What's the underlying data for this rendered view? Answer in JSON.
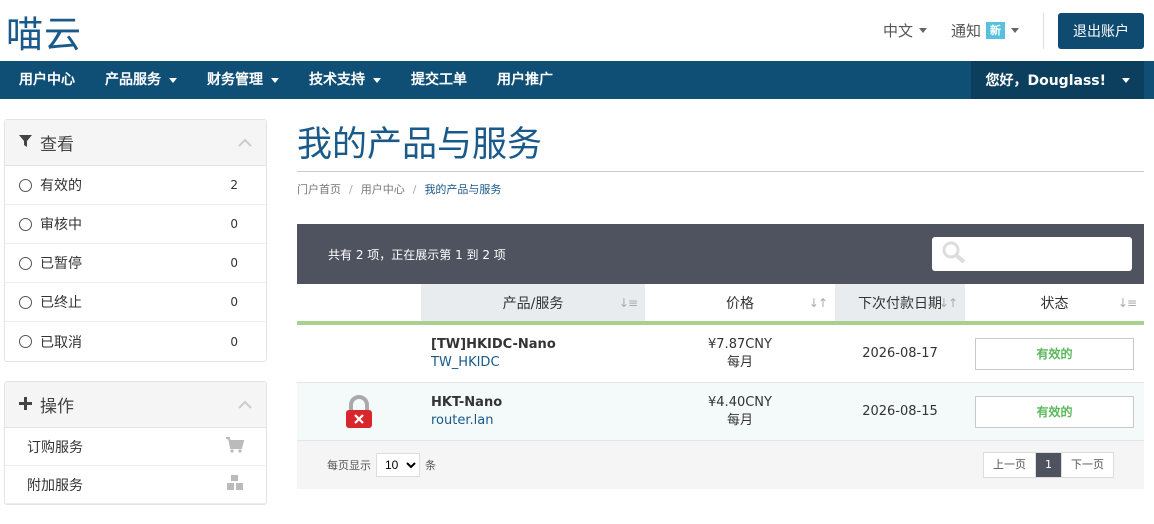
{
  "header": {
    "logo": "喵云",
    "lang_label": "中文",
    "notify_label": "通知",
    "notify_badge": "新",
    "logout_label": "退出账户"
  },
  "nav": {
    "items": [
      {
        "label": "用户中心",
        "dropdown": false
      },
      {
        "label": "产品服务",
        "dropdown": true
      },
      {
        "label": "财务管理",
        "dropdown": true
      },
      {
        "label": "技术支持",
        "dropdown": true
      },
      {
        "label": "提交工单",
        "dropdown": false
      },
      {
        "label": "用户推广",
        "dropdown": false
      }
    ],
    "user_greeting": "您好，Douglass!"
  },
  "sidebar": {
    "view_title": "查看",
    "filters": [
      {
        "label": "有效的",
        "count": "2"
      },
      {
        "label": "审核中",
        "count": "0"
      },
      {
        "label": "已暂停",
        "count": "0"
      },
      {
        "label": "已终止",
        "count": "0"
      },
      {
        "label": "已取消",
        "count": "0"
      }
    ],
    "actions_title": "操作",
    "actions": [
      {
        "label": "订购服务",
        "icon": "cart-icon"
      },
      {
        "label": "附加服务",
        "icon": "cubes-icon"
      }
    ]
  },
  "main": {
    "title": "我的产品与服务",
    "breadcrumb": [
      "门户首页",
      "用户中心",
      "我的产品与服务"
    ],
    "table_info": "共有 2 项，正在展示第 1 到 2 项",
    "search_placeholder": "",
    "columns": [
      "产品/服务",
      "价格",
      "下次付款日期",
      "状态"
    ],
    "rows": [
      {
        "name": "[TW]HKIDC-Nano",
        "domain": "TW_HKIDC",
        "price": "¥7.87CNY",
        "cycle": "每月",
        "next_due": "2026-08-17",
        "status": "有效的",
        "locked": false
      },
      {
        "name": "HKT-Nano",
        "domain": "router.lan",
        "price": "¥4.40CNY",
        "cycle": "每月",
        "next_due": "2026-08-15",
        "status": "有效的",
        "locked": true
      }
    ],
    "per_page_label": "每页显示",
    "per_page_value": "10",
    "per_page_suffix": "条",
    "pager": {
      "prev": "上一页",
      "current": "1",
      "next": "下一页"
    }
  },
  "colors": {
    "primary": "#0f4f76",
    "title": "#1a5a8a",
    "status_green": "#5cb85c",
    "table_head": "#4f535f",
    "accent_rule": "#a9d18e"
  }
}
